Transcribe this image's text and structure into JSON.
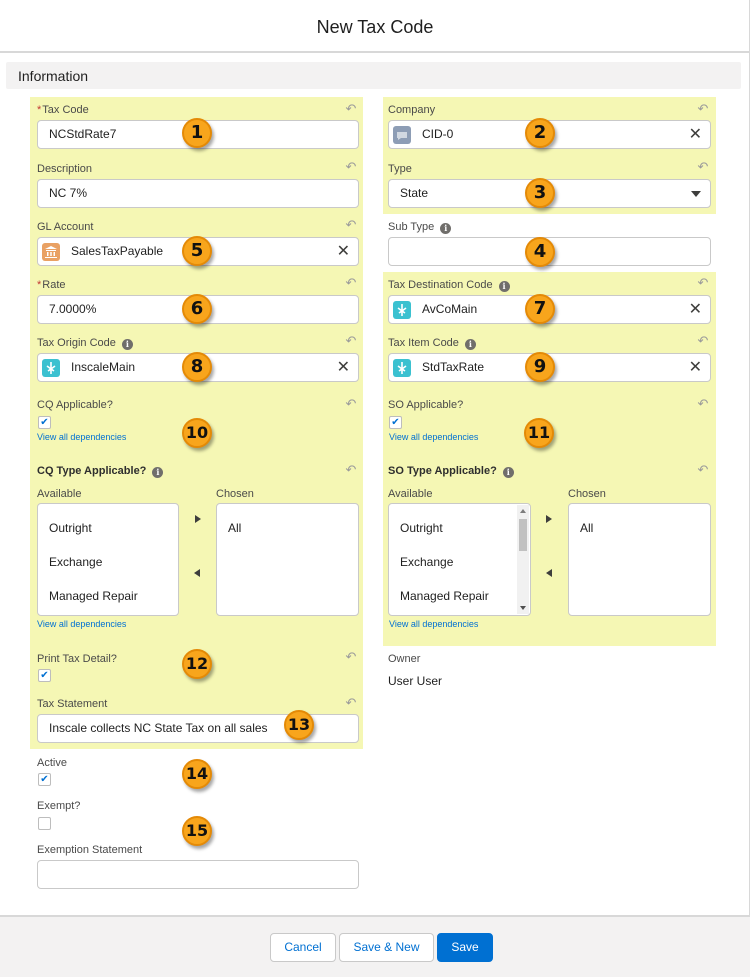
{
  "modal": {
    "title": "New Tax Code"
  },
  "section": {
    "title": "Information"
  },
  "colors": {
    "highlight": "#f5f7b4",
    "badge": "#f8a51c",
    "brand": "#0070d2"
  },
  "fields": {
    "tax_code": {
      "label": "Tax Code",
      "value": "NCStdRate7"
    },
    "company": {
      "label": "Company",
      "value": "CID-0",
      "icon": "company-icon"
    },
    "description": {
      "label": "Description",
      "value": "NC 7%"
    },
    "type": {
      "label": "Type",
      "value": "State"
    },
    "gl_account": {
      "label": "GL Account",
      "value": "SalesTaxPayable",
      "icon": "bank-icon"
    },
    "sub_type": {
      "label": "Sub Type",
      "value": ""
    },
    "rate": {
      "label": "Rate",
      "value": "7.0000%"
    },
    "tax_destination_code": {
      "label": "Tax Destination Code",
      "value": "AvCoMain",
      "icon": "lookup-icon"
    },
    "tax_origin_code": {
      "label": "Tax Origin Code",
      "value": "InscaleMain",
      "icon": "lookup-icon"
    },
    "tax_item_code": {
      "label": "Tax Item Code",
      "value": "StdTaxRate",
      "icon": "lookup-icon"
    },
    "cq_applicable": {
      "label": "CQ Applicable?",
      "checked": true
    },
    "so_applicable": {
      "label": "SO Applicable?",
      "checked": true
    },
    "cq_type_applicable": {
      "label": "CQ Type Applicable?",
      "available_label": "Available",
      "chosen_label": "Chosen",
      "available": [
        "Outright",
        "Exchange",
        "Managed Repair"
      ],
      "chosen": [
        "All"
      ]
    },
    "so_type_applicable": {
      "label": "SO Type Applicable?",
      "available_label": "Available",
      "chosen_label": "Chosen",
      "available": [
        "Outright",
        "Exchange",
        "Managed Repair"
      ],
      "chosen": [
        "All"
      ]
    },
    "print_tax_detail": {
      "label": "Print Tax Detail?",
      "checked": true
    },
    "owner": {
      "label": "Owner",
      "value": "User User"
    },
    "tax_statement": {
      "label": "Tax Statement",
      "value": "Inscale collects NC State Tax on all sales"
    },
    "active": {
      "label": "Active",
      "checked": true
    },
    "exempt": {
      "label": "Exempt?",
      "checked": false
    },
    "exemption_statement": {
      "label": "Exemption Statement",
      "value": ""
    }
  },
  "links": {
    "view_all_dependencies": "View all dependencies"
  },
  "badges": [
    "1",
    "2",
    "3",
    "4",
    "5",
    "6",
    "7",
    "8",
    "9",
    "10",
    "11",
    "12",
    "13",
    "14",
    "15"
  ],
  "footer": {
    "cancel": "Cancel",
    "save_new": "Save & New",
    "save": "Save"
  }
}
